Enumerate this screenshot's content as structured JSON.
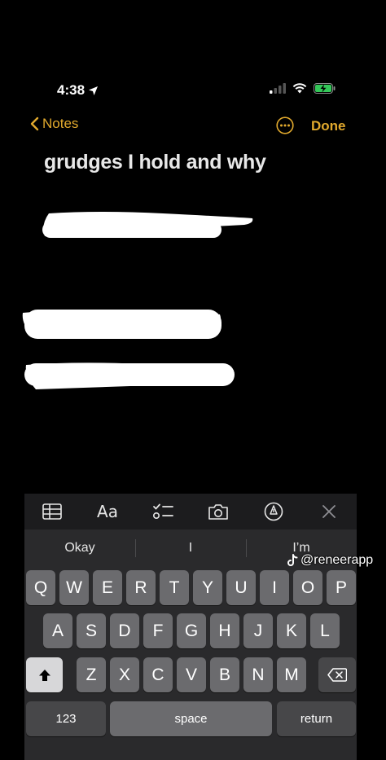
{
  "status": {
    "time": "4:38"
  },
  "nav": {
    "back_label": "Notes",
    "done_label": "Done"
  },
  "note": {
    "title": "grudges I hold and why"
  },
  "toolbar": {
    "format_label": "Aa"
  },
  "predictions": [
    "Okay",
    "I",
    "I’m"
  ],
  "keyboard": {
    "row1": [
      "Q",
      "W",
      "E",
      "R",
      "T",
      "Y",
      "U",
      "I",
      "O",
      "P"
    ],
    "row2": [
      "A",
      "S",
      "D",
      "F",
      "G",
      "H",
      "J",
      "K",
      "L"
    ],
    "row3": [
      "Z",
      "X",
      "C",
      "V",
      "B",
      "N",
      "M"
    ],
    "numbers_label": "123",
    "space_label": "space",
    "return_label": "return"
  },
  "watermark": {
    "handle": "@reneerapp"
  },
  "colors": {
    "accent": "#e1a92d",
    "background": "#000000",
    "key": "#6b6b6e",
    "keyboard_bg": "#2a2a2c"
  }
}
